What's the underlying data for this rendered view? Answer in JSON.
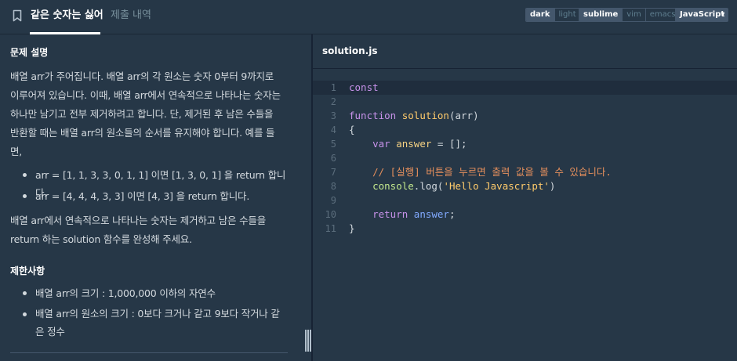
{
  "header": {
    "tab_active": "같은 숫자는 싫어",
    "tab_inactive": "제출 내역",
    "theme_options": [
      "dark",
      "light"
    ],
    "theme_selected": "dark",
    "editor_options": [
      "sublime",
      "vim",
      "emacs"
    ],
    "editor_selected": "sublime",
    "language": "JavaScript"
  },
  "problem": {
    "title": "문제 설명",
    "para1_lines": [
      "배열 arr가 주어집니다. 배열 arr의 각 원소는 숫자 0부터 9까지로",
      "이루어져 있습니다. 이때, 배열 arr에서 연속적으로 나타나는 숫자는",
      "하나만 남기고 전부 제거하려고 합니다. 단, 제거된 후 남은 수들을",
      "반환할 때는 배열 arr의 원소들의 순서를 유지해야 합니다. 예를 들",
      "면,"
    ],
    "examples": [
      "arr = [1, 1, 3, 3, 0, 1, 1] 이면 [1, 3, 0, 1] 을 return 합니다.",
      "arr = [4, 4, 4, 3, 3] 이면 [4, 3] 을 return 합니다."
    ],
    "para2_lines": [
      "배열 arr에서 연속적으로 나타나는 숫자는 제거하고 남은 수들을",
      "return 하는 solution 함수를 완성해 주세요."
    ]
  },
  "constraints": {
    "title": "제한사항",
    "items": [
      [
        "배열 arr의 크기 : 1,000,000 이하의 자연수"
      ],
      [
        "배열 arr의 원소의 크기 : 0보다 크거나 같고 9보다 작거나 같",
        "은 정수"
      ]
    ]
  },
  "editor": {
    "filename": "solution.js",
    "line_numbers": [
      "1",
      "2",
      "3",
      "4",
      "5",
      "6",
      "7",
      "8",
      "9",
      "10",
      "11"
    ],
    "code": {
      "l1_kw": "const",
      "l3_kw": "function",
      "l3_fn": "solution",
      "l3_rest": "(arr)",
      "l4": "{",
      "l5_kw": "var",
      "l5_var": "answer",
      "l5_rest": " = [];",
      "l7_comment": "// [실행] 버튼을 누르면 출력 값을 볼 수 있습니다.",
      "l8_obj": "console",
      "l8_mid": ".log(",
      "l8_str": "'Hello Javascript'",
      "l8_end": ")",
      "l10_kw": "return",
      "l10_var": "answer",
      "l10_end": ";",
      "l11": "}"
    }
  },
  "colors": {
    "background": "#263747",
    "keyword": "#c792ea",
    "function": "#ffcb6b",
    "comment": "#e58f5c",
    "string": "#c3e88d"
  }
}
